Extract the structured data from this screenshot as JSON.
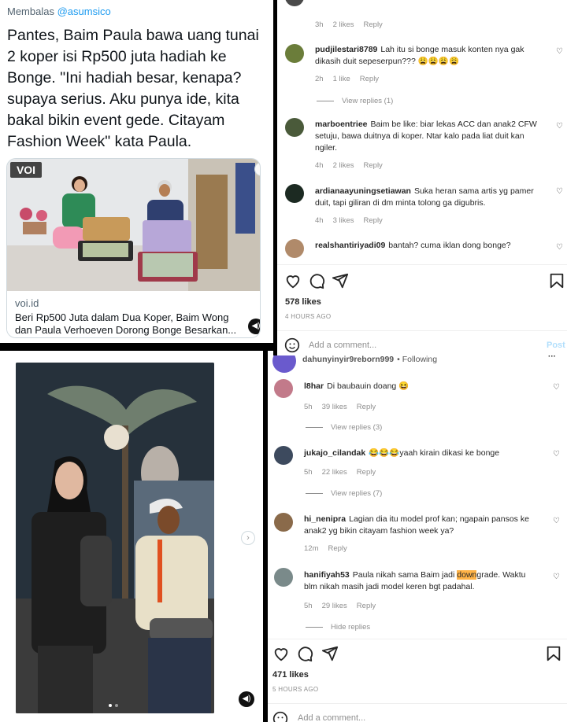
{
  "tweet": {
    "reply_prefix": "Membalas",
    "reply_handle": "@asumsico",
    "text": "Pantes, Baim Paula bawa uang tunai 2 koper isi Rp500 juta hadiah ke Bonge. \"Ini hadiah besar, kenapa? supaya serius. Aku punya ide, kita bakal bikin event gede. Citayam Fashion Week\" kata Paula.",
    "card": {
      "logo": "VOI",
      "domain": "voi.id",
      "title": "Beri Rp500 Juta dalam Dua Koper, Baim Wong dan Paula Verhoeven Dorong Bonge Besarkan...",
      "sound_icon": "speaker-icon"
    }
  },
  "ig_post_1": {
    "top_comment_meta": {
      "time": "3h",
      "likes": "2 likes",
      "reply": "Reply"
    },
    "comments": [
      {
        "user": "pudjilestari8789",
        "text": "Lah itu si bonge masuk konten nya gak dikasih duit sepeserpun??? 😩😩😩😩",
        "time": "2h",
        "likes": "1 like",
        "reply": "Reply",
        "view_replies": "View replies (1)",
        "avatar_color": "#6b7d3a"
      },
      {
        "user": "marboentriee",
        "text": "Baim be like: biar lekas ACC dan anak2 CFW setuju, bawa duitnya di koper. Ntar kalo pada liat duit kan ngiler.",
        "time": "4h",
        "likes": "2 likes",
        "reply": "Reply",
        "avatar_color": "#4a5a3a"
      },
      {
        "user": "ardianaayuningsetiawan",
        "text": "Suka heran sama artis yg pamer duit, tapi giliran di dm minta tolong ga digubris.",
        "time": "4h",
        "likes": "3 likes",
        "reply": "Reply",
        "avatar_color": "#1c2a22"
      },
      {
        "user": "realshantiriyadi09",
        "text": "bantah? cuma iklan dong bonge?",
        "avatar_color": "#b08a6a"
      }
    ],
    "likes": "578 likes",
    "time_ago": "4 HOURS AGO",
    "add_comment_placeholder": "Add a comment...",
    "post_label": "Post"
  },
  "ig_post_2": {
    "header_user": "dahunyinyir9reborn999",
    "header_following": "• Following",
    "comments": [
      {
        "user": "l8har",
        "text": "Di baubauin doang 😆",
        "time": "5h",
        "likes": "39 likes",
        "reply": "Reply",
        "view_replies": "View replies (3)",
        "avatar_color": "#c27a8a"
      },
      {
        "user": "jukajo_cilandak",
        "text": "😂😂😂yaah kirain dikasi ke bonge",
        "time": "5h",
        "likes": "22 likes",
        "reply": "Reply",
        "view_replies": "View replies (7)",
        "avatar_color": "#3d4a5e"
      },
      {
        "user": "hi_nenipra",
        "text": "Lagian dia itu model prof kan; ngapain pansos ke anak2 yg bikin citayam fashion week ya?",
        "time": "12m",
        "reply": "Reply",
        "avatar_color": "#8a6a4a"
      },
      {
        "user": "hanifiyah53",
        "text_before": "Paula nikah sama Baim jadi ",
        "text_highlight": "down",
        "text_after": "grade. Waktu blm nikah masih jadi model keren bgt padahal.",
        "time": "5h",
        "likes": "29 likes",
        "reply": "Reply",
        "view_replies": "Hide replies",
        "avatar_color": "#7a8a8a"
      }
    ],
    "likes": "471 likes",
    "time_ago": "5 HOURS AGO",
    "add_comment_placeholder": "Add a comment..."
  }
}
